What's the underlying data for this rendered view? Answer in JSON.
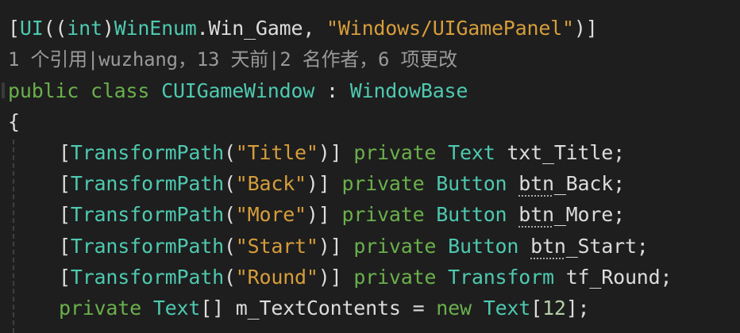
{
  "code": {
    "line1": {
      "open": "[",
      "attr": "UI",
      "paren1": "((",
      "kw_int": "int",
      "paren2": ")",
      "enum": "WinEnum",
      "dot": ".",
      "member": "Win_Game",
      "comma": ", ",
      "string": "\"Windows/UIGamePanel\"",
      "close": ")]"
    },
    "codelens": "1 个引用|wuzhang，13 天前|2 名作者，6 项更改",
    "line3": {
      "kw_public": "public",
      "kw_class": "class",
      "classname": "CUIGameWindow",
      "colon": ":",
      "base": "WindowBase"
    },
    "brace_open": "{",
    "fields": [
      {
        "attr_open": "[",
        "attr": "TransformPath",
        "paren_open": "(",
        "string": "\"Title\"",
        "paren_close": ")]",
        "kw_private": "private",
        "type": "Text",
        "name": "txt_Title",
        "end": ";"
      },
      {
        "attr_open": "[",
        "attr": "TransformPath",
        "paren_open": "(",
        "string": "\"Back\"",
        "paren_close": ")]",
        "kw_private": "private",
        "type": "Button",
        "name_prefix": "btn",
        "name_rest": "_Back",
        "end": ";"
      },
      {
        "attr_open": "[",
        "attr": "TransformPath",
        "paren_open": "(",
        "string": "\"More\"",
        "paren_close": ")]",
        "kw_private": "private",
        "type": "Button",
        "name_prefix": "btn",
        "name_rest": "_More",
        "end": ";"
      },
      {
        "attr_open": "[",
        "attr": "TransformPath",
        "paren_open": "(",
        "string": "\"Start\"",
        "paren_close": ")]",
        "kw_private": "private",
        "type": "Button",
        "name_prefix": "btn",
        "name_rest": "_Start",
        "end": ";"
      },
      {
        "attr_open": "[",
        "attr": "TransformPath",
        "paren_open": "(",
        "string": "\"Round\"",
        "paren_close": ")]",
        "kw_private": "private",
        "type": "Transform",
        "name": "tf_Round",
        "end": ";"
      }
    ],
    "last": {
      "kw_private": "private",
      "type": "Text",
      "brackets": "[]",
      "name": "m_TextContents",
      "eq": "=",
      "kw_new": "new",
      "type2": "Text",
      "open": "[",
      "num": "12",
      "close": "];"
    }
  },
  "colors": {
    "background": "#1e1e1e",
    "type": "#4ec9b0",
    "keyword": "#6ab04c",
    "string": "#d69d3b",
    "identifier": "#dcdcdc",
    "codelens": "#999999"
  }
}
